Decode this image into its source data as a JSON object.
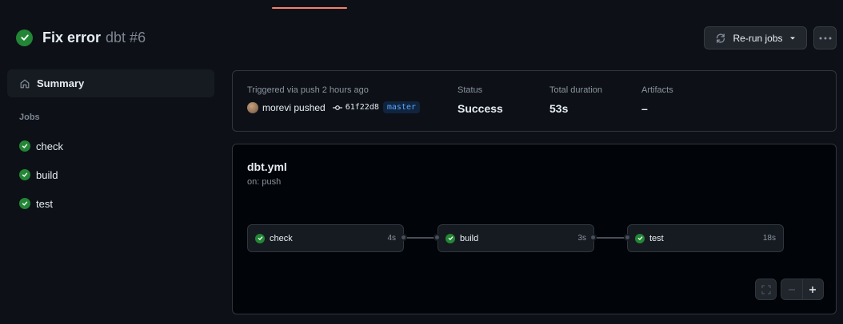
{
  "header": {
    "title": "Fix error",
    "run_name": "dbt #6",
    "rerun_label": "Re-run jobs"
  },
  "sidebar": {
    "summary_label": "Summary",
    "jobs_heading": "Jobs",
    "jobs": [
      {
        "label": "check"
      },
      {
        "label": "build"
      },
      {
        "label": "test"
      }
    ]
  },
  "summary": {
    "trigger_text": "Triggered via push 2 hours ago",
    "actor": "morevi pushed",
    "commit_sha": "61f22d8",
    "branch": "master",
    "status_label": "Status",
    "status_value": "Success",
    "duration_label": "Total duration",
    "duration_value": "53s",
    "artifacts_label": "Artifacts",
    "artifacts_value": "–"
  },
  "workflow": {
    "file": "dbt.yml",
    "trigger": "on: push",
    "jobs": [
      {
        "label": "check",
        "time": "4s"
      },
      {
        "label": "build",
        "time": "3s"
      },
      {
        "label": "test",
        "time": "18s"
      }
    ]
  },
  "colors": {
    "success": "#238636",
    "accent": "#f78166",
    "branch": "#58a6ff"
  }
}
